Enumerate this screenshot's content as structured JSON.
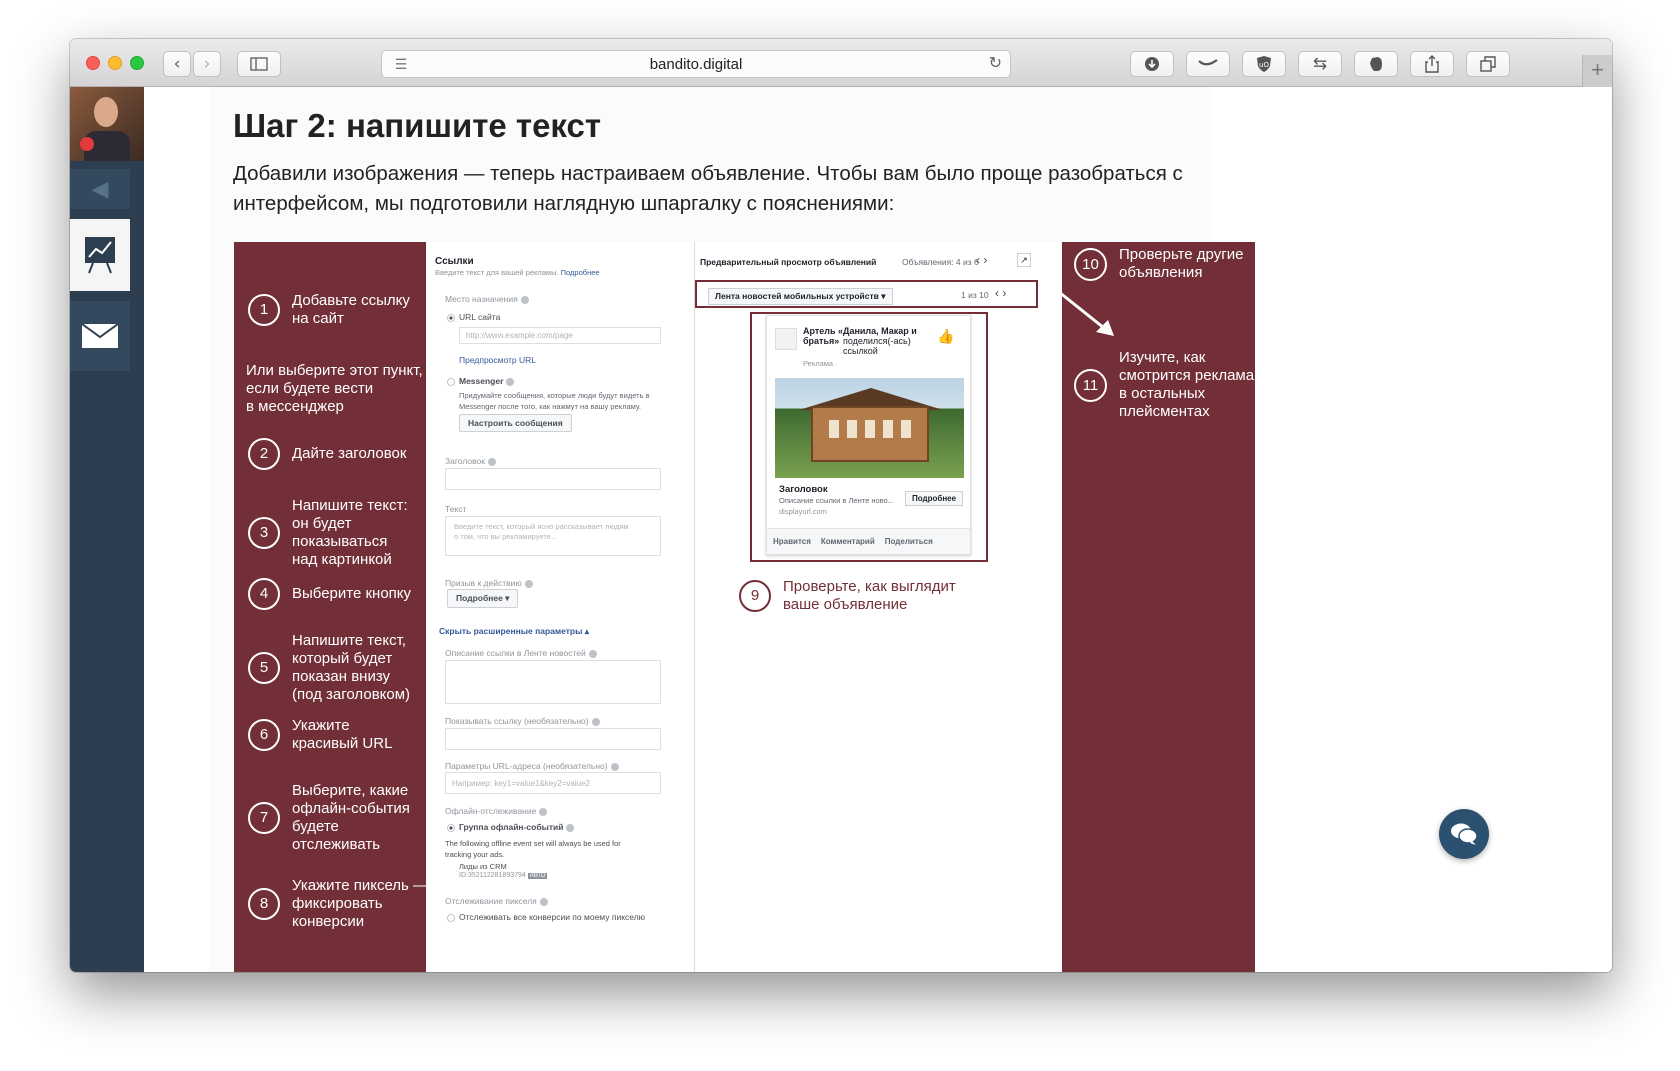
{
  "browser": {
    "url": "bandito.digital",
    "icons": [
      "back-icon",
      "forward-icon",
      "sidebar-icon",
      "reader-icon",
      "reload-icon",
      "download-icon",
      "extension-icon",
      "shield-icon",
      "translate-icon",
      "evernote-icon",
      "share-icon",
      "tabs-icon",
      "new-tab-icon"
    ]
  },
  "article": {
    "title": "Шаг 2: напишите текст",
    "intro": "Добавили изображения — теперь настраиваем объявление. Чтобы вам было проще разобраться с интерфейсом, мы подготовили наглядную шпаргалку с пояснениями:"
  },
  "infographic": {
    "accent_color": "#722f37",
    "steps_left": [
      {
        "num": "1",
        "text": "Добавьте ссылку\nна сайт"
      },
      {
        "num": "",
        "text": "Или выберите этот пункт,\nесли будете вести\nв мессенджер"
      },
      {
        "num": "2",
        "text": "Дайте заголовок"
      },
      {
        "num": "3",
        "text": "Напишите текст:\nон будет\nпоказываться\nнад картинкой"
      },
      {
        "num": "4",
        "text": "Выберите кнопку"
      },
      {
        "num": "5",
        "text": "Напишите текст,\nкоторый будет\nпоказан внизу\n(под заголовком)"
      },
      {
        "num": "6",
        "text": "Укажите\nкрасивый URL"
      },
      {
        "num": "7",
        "text": "Выберите, какие\nофлайн-события\nбудете\nотслеживать"
      },
      {
        "num": "8",
        "text": "Укажите пиксель —\nфиксировать\nконверсии"
      }
    ],
    "steps_right": [
      {
        "num": "10",
        "text": "Проверьте другие\nобъявления"
      },
      {
        "num": "11",
        "text": "Изучите, как\nсмотрится реклама\nв остальных\nплейсментах"
      }
    ],
    "step9": {
      "num": "9",
      "text": "Проверьте, как выглядит\nваше объявление"
    },
    "form": {
      "links_title": "Ссылки",
      "links_hint": "Введите текст для вашей рекламы.",
      "links_more": "Подробнее",
      "destination_label": "Место назначения",
      "url_option": "URL сайта",
      "url_placeholder": "http://www.example.com/page",
      "preview_url": "Предпросмотр URL",
      "messenger_option": "Messenger",
      "messenger_hint": "Придумайте сообщения, которые люди будут видеть в\nMessenger после того, как нажмут на вашу рекламу.",
      "messenger_button": "Настроить сообщения",
      "headline_label": "Заголовок",
      "text_label": "Текст",
      "text_placeholder": "Введите текст, который ясно рассказывает людям\nо том, что вы рекламируете...",
      "cta_label": "Призыв к действию",
      "cta_value": "Подробнее ▾",
      "hide_advanced": "Скрыть расширенные параметры ▴",
      "news_desc_label": "Описание ссылки в Ленте новостей",
      "display_link_label": "Показывать ссылку (необязательно)",
      "url_params_label": "Параметры URL-адреса (необязательно)",
      "url_params_placeholder": "Например: key1=value1&key2=value2",
      "offline_label": "Офлайн-отслеживание",
      "offline_group": "Группа офлайн-событий",
      "offline_note": "The following offline event set will always be used for\ntracking your ads.",
      "crm_leads": "Лиды из CRM",
      "crm_id": "ID:352112281893794",
      "auto_badge": "АВТО",
      "pixel_label": "Отслеживание пикселя",
      "pixel_option": "Отслеживать все конверсии по моему пикселю"
    },
    "preview": {
      "title": "Предварительный просмотр объявлений",
      "counter": "Объявления: 4 из 6",
      "placement": "Лента новостей мобильных устройств ▾",
      "placement_counter": "1 из 10",
      "page_name": "Артель «Данила, Макар и\nбратья»",
      "shared_text": "поделился(-ась)\nссылкой",
      "sponsored": "Реклама · ",
      "headline": "Заголовок",
      "link_desc": "Описание ссылки в Ленте ново...",
      "display_url": "displayurl.com",
      "cta": "Подробнее",
      "like": "Нравится",
      "comment": "Комментарий",
      "share": "Поделиться"
    }
  }
}
